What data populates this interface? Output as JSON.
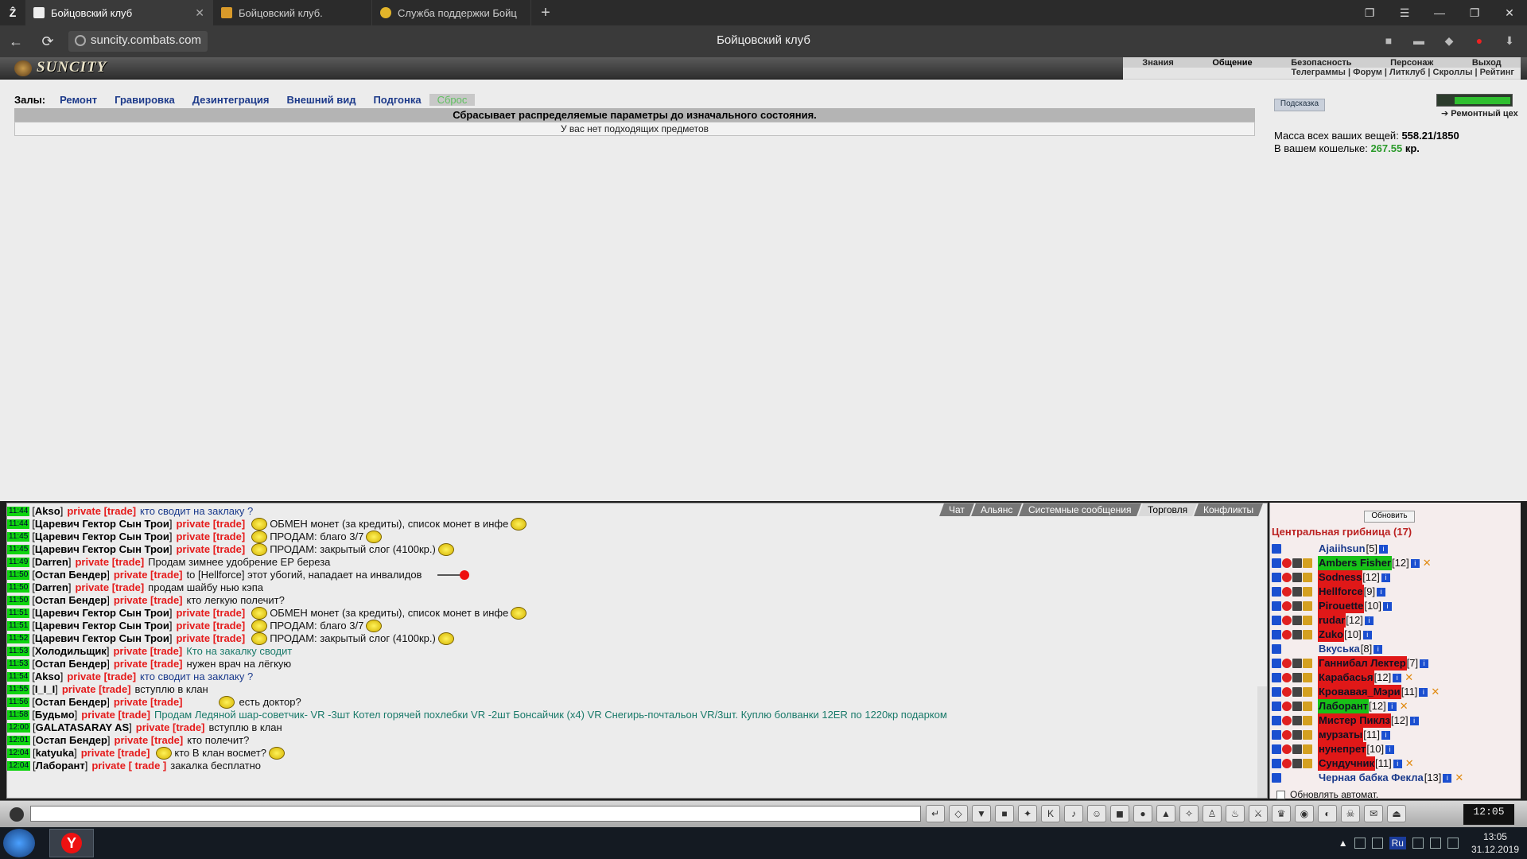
{
  "browser": {
    "tabs": [
      {
        "label": "Бойцовский клуб",
        "active": true
      },
      {
        "label": "Бойцовский клуб.",
        "active": false
      },
      {
        "label": "Служба поддержки Бойц",
        "active": false
      }
    ],
    "new_tab": "+",
    "url": "suncity.combats.com",
    "page_title": "Бойцовский клуб"
  },
  "game": {
    "logo": "SUNCITY",
    "top_menu": [
      "Знания",
      "Общение",
      "Безопасность",
      "Персонаж",
      "Выход"
    ],
    "top_menu_selected": "Общение",
    "sub_menu": "Телеграммы | Форум | Литклуб | Скроллы | Рейтинг"
  },
  "halls": {
    "label": "Залы:",
    "items": [
      "Ремонт",
      "Гравировка",
      "Дезинтеграция",
      "Внешний вид",
      "Подгонка",
      "Сброс"
    ],
    "active": "Сброс"
  },
  "reset_notice": "Сбрасывает распределяемые параметры до изначального состояния.",
  "no_items": "У вас нет подходящих предметов",
  "side": {
    "hint_button": "Подсказка",
    "repair_label": "Ремонтный цех",
    "mass_label": "Масса всех ваших вещей:",
    "mass_value": "558.21/1850",
    "wallet_label": "В вашем кошельке:",
    "wallet_value": "267.55",
    "wallet_unit": "кр."
  },
  "chat_tabs": [
    "Чат",
    "Альянс",
    "Системные сообщения",
    "Торговля",
    "Конфликты"
  ],
  "chat_tab_selected": "Торговля",
  "messages": [
    {
      "time": "11:44",
      "nick": "Akso",
      "tag": "private [trade]",
      "text": "кто сводит на заклаку ?",
      "style": "blue"
    },
    {
      "time": "11:44",
      "nick": "Царевич Гектор Сын Трои",
      "tag": "private [trade]",
      "text": "ОБМЕН монет (за кредиты), список монет в инфе",
      "style": "dark",
      "smile": true,
      "smile_after": true
    },
    {
      "time": "11:45",
      "nick": "Царевич Гектор Сын Трои",
      "tag": "private [trade]",
      "text": "ПРОДАМ: благо 3/7",
      "style": "dark",
      "smile": true,
      "smile_after": true
    },
    {
      "time": "11:45",
      "nick": "Царевич Гектор Сын Трои",
      "tag": "private [trade]",
      "text": "ПРОДАМ: закрытый слог (4100кр.)",
      "style": "dark",
      "smile": true,
      "smile_after": true
    },
    {
      "time": "11:49",
      "nick": "Darren",
      "tag": "private [trade]",
      "text": "Продам зимнее удобрение ЕР береза",
      "style": "dark"
    },
    {
      "time": "11:50",
      "nick": "Остап Бендер",
      "tag": "private [trade]",
      "text": "to [Hellforce] этот убогий, нападает на инвалидов",
      "style": "dark",
      "gun": true
    },
    {
      "time": "11:50",
      "nick": "Darren",
      "tag": "private [trade]",
      "text": "продам шайбу нью кэпа",
      "style": "dark"
    },
    {
      "time": "11:50",
      "nick": "Остап Бендер",
      "tag": "private [trade]",
      "text": "кто легкую полечит?",
      "style": "dark"
    },
    {
      "time": "11:51",
      "nick": "Царевич Гектор Сын Трои",
      "tag": "private [trade]",
      "text": "ОБМЕН монет (за кредиты), список монет в инфе",
      "style": "dark",
      "smile": true,
      "smile_after": true
    },
    {
      "time": "11:51",
      "nick": "Царевич Гектор Сын Трои",
      "tag": "private [trade]",
      "text": "ПРОДАМ: благо 3/7",
      "style": "dark",
      "smile": true,
      "smile_after": true
    },
    {
      "time": "11:52",
      "nick": "Царевич Гектор Сын Трои",
      "tag": "private [trade]",
      "text": "ПРОДАМ: закрытый слог (4100кр.)",
      "style": "dark",
      "smile": true,
      "smile_after": true
    },
    {
      "time": "11:53",
      "nick": "Холодильщик",
      "tag": "private [trade]",
      "text": "Кто на закалку сводит",
      "style": "teal"
    },
    {
      "time": "11:53",
      "nick": "Остап Бендер",
      "tag": "private [trade]",
      "text": "нужен врач на лёгкую",
      "style": "dark"
    },
    {
      "time": "11:54",
      "nick": "Akso",
      "tag": "private [trade]",
      "text": "кто сводит на заклаку ?",
      "style": "blue"
    },
    {
      "time": "11:55",
      "nick": "I_I_I",
      "tag": "private [trade]",
      "text": "вступлю в клан",
      "style": "dark"
    },
    {
      "time": "11:56",
      "nick": "Остап Бендер",
      "tag": "private [trade]",
      "text": "есть доктор?",
      "style": "dark",
      "smile_before": true
    },
    {
      "time": "11:58",
      "nick": "Будьмо",
      "tag": "private [trade]",
      "text": "Продам    Ледяной шар-советчик- VR -3шт Котел горячей похлебки  VR -2шт Бонсайчик (x4)  VR  Снегирь-почтальон  VR/3шт.  Куплю болванки 12ER по 1220кр подарком",
      "style": "teal"
    },
    {
      "time": "12:00",
      "nick": "GALATASARAY AS",
      "tag": "private [trade]",
      "text": "вступлю в клан",
      "style": "dark"
    },
    {
      "time": "12:01",
      "nick": "Остап Бендер",
      "tag": "private [trade]",
      "text": "кто полечит?",
      "style": "dark"
    },
    {
      "time": "12:04",
      "nick": "katyuka",
      "tag": "private [trade]",
      "text": "кто В клан восмет?",
      "style": "dark",
      "smile": true,
      "smile_after": true
    },
    {
      "time": "12:04",
      "nick": "Лаборант",
      "tag": "private [ trade ]",
      "text": "закалка бесплатно",
      "style": "dark"
    }
  ],
  "users_panel": {
    "refresh": "Обновить",
    "room": "Центральная грибница (17)",
    "auto_refresh": "Обновлять автомат.",
    "users": [
      {
        "name": "Ajaiihsun",
        "level": "[5]",
        "style": "none"
      },
      {
        "name": "Ambers Fisher",
        "level": "[12]",
        "style": "green",
        "x": true
      },
      {
        "name": "Sodness",
        "level": "[12]",
        "style": "red"
      },
      {
        "name": "Hellforce",
        "level": "[9]",
        "style": "red"
      },
      {
        "name": "Pirouette",
        "level": "[10]",
        "style": "red"
      },
      {
        "name": "rudar",
        "level": "[12]",
        "style": "red"
      },
      {
        "name": "Zuko",
        "level": "[10]",
        "style": "red"
      },
      {
        "name": "Вкуська",
        "level": "[8]",
        "style": "none"
      },
      {
        "name": "Ганнибал Лектер",
        "level": "[7]",
        "style": "red"
      },
      {
        "name": "Карабасья",
        "level": "[12]",
        "style": "red",
        "x": true
      },
      {
        "name": "Кровавая_Мэри",
        "level": "[11]",
        "style": "red",
        "x": true
      },
      {
        "name": "Лаборант",
        "level": "[12]",
        "style": "green",
        "x": true
      },
      {
        "name": "Мистер Пиклз",
        "level": "[12]",
        "style": "red"
      },
      {
        "name": "мурзаты",
        "level": "[11]",
        "style": "red"
      },
      {
        "name": "нунепрет",
        "level": "[10]",
        "style": "red"
      },
      {
        "name": "Сундучник",
        "level": "[11]",
        "style": "red",
        "x": true
      },
      {
        "name": "Черная бабка Фекла",
        "level": "[13]",
        "style": "none",
        "x": true
      }
    ]
  },
  "input": {
    "placeholder": ""
  },
  "clock": "12:05",
  "taskbar": {
    "time": "13:05",
    "date": "31.12.2019",
    "lang": "Ru"
  }
}
